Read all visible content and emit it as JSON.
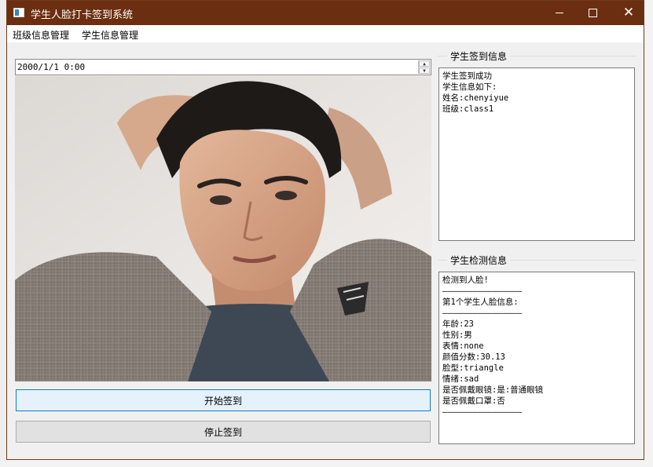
{
  "window": {
    "title": "学生人脸打卡签到系统",
    "controls": {
      "minimize": "minimize-icon",
      "maximize": "maximize-icon",
      "close": "✕"
    }
  },
  "menu": {
    "items": [
      {
        "label": "班级信息管理"
      },
      {
        "label": "学生信息管理"
      }
    ]
  },
  "datetime_edit": {
    "value": "2000/1/1 0:00"
  },
  "buttons": {
    "start": "开始签到",
    "stop": "停止签到"
  },
  "signin_panel": {
    "title": "学生签到信息",
    "lines": [
      "学生签到成功",
      "学生信息如下:",
      "姓名:chenyiyue",
      "班级:class1"
    ]
  },
  "detect_panel": {
    "title": "学生检测信息",
    "lines": [
      "检测到人脸!",
      "————————————————",
      "第1个学生人脸信息:",
      "————————————————",
      "年龄:23",
      "性别:男",
      "表情:none",
      "颜值分数:30.13",
      "脸型:triangle",
      "情绪:sad",
      "是否佩戴眼镜:是:普通眼镜",
      "是否佩戴口罩:否",
      "————————————————"
    ]
  },
  "colors": {
    "titlebar": "#6b2e10",
    "accent": "#0f7cc8"
  }
}
